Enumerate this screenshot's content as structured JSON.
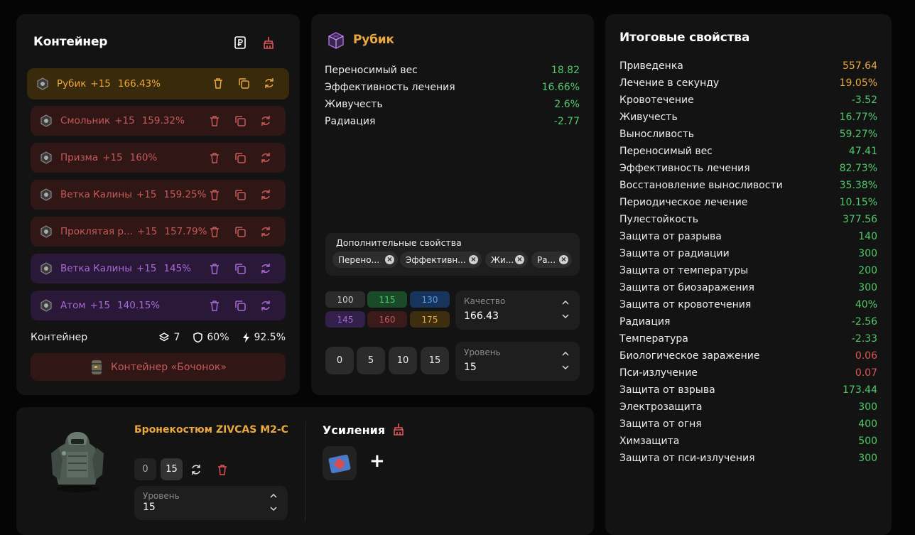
{
  "container": {
    "title": "Контейнер",
    "items": [
      {
        "name": "Рубик",
        "level": "+15",
        "percent": "166.43%",
        "style": "gold"
      },
      {
        "name": "Смольник",
        "level": "+15",
        "percent": "159.32%",
        "style": "red"
      },
      {
        "name": "Призма",
        "level": "+15",
        "percent": "160%",
        "style": "red"
      },
      {
        "name": "Ветка Калины",
        "level": "+15",
        "percent": "159.25%",
        "style": "red"
      },
      {
        "name": "Проклятая р...",
        "level": "+15",
        "percent": "157.79%",
        "style": "red"
      },
      {
        "name": "Ветка Калины",
        "level": "+15",
        "percent": "145%",
        "style": "purple"
      },
      {
        "name": "Атом",
        "level": "+15",
        "percent": "140.15%",
        "style": "purple"
      }
    ],
    "footer": {
      "label": "Контейнер",
      "slots": "7",
      "protection": "60%",
      "efficiency": "92.5%"
    },
    "selected_container": "Контейнер «Бочонок»"
  },
  "artifact": {
    "name": "Рубик",
    "stats": [
      {
        "label": "Переносимый вес",
        "value": "18.82"
      },
      {
        "label": "Эффективность лечения",
        "value": "16.66%"
      },
      {
        "label": "Живучесть",
        "value": "2.6%"
      },
      {
        "label": "Радиация",
        "value": "-2.77"
      }
    ],
    "extra": {
      "label": "Дополнительные свойства",
      "chips": [
        "Перено...",
        "Эффективн...",
        "Жи...",
        "Ра..."
      ]
    },
    "quality_presets": [
      "100",
      "115",
      "130",
      "145",
      "160",
      "175"
    ],
    "quality": {
      "label": "Качество",
      "value": "166.43"
    },
    "level_presets": [
      "0",
      "5",
      "10",
      "15"
    ],
    "level": {
      "label": "Уровень",
      "value": "15"
    }
  },
  "summary": {
    "title": "Итоговые свойства",
    "rows": [
      {
        "label": "Приведенка",
        "value": "557.64",
        "color": "orange"
      },
      {
        "label": "Лечение в секунду",
        "value": "19.05%",
        "color": "orange"
      },
      {
        "label": "Кровотечение",
        "value": "-3.52",
        "color": "green"
      },
      {
        "label": "Живучесть",
        "value": "16.77%",
        "color": "green"
      },
      {
        "label": "Выносливость",
        "value": "59.27%",
        "color": "green"
      },
      {
        "label": "Переносимый вес",
        "value": "47.41",
        "color": "green"
      },
      {
        "label": "Эффективность лечения",
        "value": "82.73%",
        "color": "green"
      },
      {
        "label": "Восстановление выносливости",
        "value": "35.38%",
        "color": "green"
      },
      {
        "label": "Периодическое лечение",
        "value": "10.15%",
        "color": "green"
      },
      {
        "label": "Пулестойкость",
        "value": "377.56",
        "color": "green"
      },
      {
        "label": "Защита от разрыва",
        "value": "140",
        "color": "green"
      },
      {
        "label": "Защита от радиации",
        "value": "300",
        "color": "green"
      },
      {
        "label": "Защита от температуры",
        "value": "200",
        "color": "green"
      },
      {
        "label": "Защита от биозаражения",
        "value": "300",
        "color": "green"
      },
      {
        "label": "Защита от кровотечения",
        "value": "40%",
        "color": "green"
      },
      {
        "label": "Радиация",
        "value": "-2.56",
        "color": "green"
      },
      {
        "label": "Температура",
        "value": "-2.33",
        "color": "green"
      },
      {
        "label": "Биологическое заражение",
        "value": "0.06",
        "color": "red"
      },
      {
        "label": "Пси-излучение",
        "value": "0.07",
        "color": "red"
      },
      {
        "label": "Защита от взрыва",
        "value": "173.44",
        "color": "green"
      },
      {
        "label": "Электрозащита",
        "value": "300",
        "color": "green"
      },
      {
        "label": "Защита от огня",
        "value": "400",
        "color": "green"
      },
      {
        "label": "Химзащита",
        "value": "500",
        "color": "green"
      },
      {
        "label": "Защита от пси-излучения",
        "value": "300",
        "color": "green"
      }
    ]
  },
  "armor": {
    "name": "Бронекостюм ZIVCAS M2-C",
    "level_presets": [
      "0",
      "15"
    ],
    "level": {
      "label": "Уровень",
      "value": "15"
    },
    "boosts_title": "Усиления",
    "add_label": "+"
  },
  "colors": {
    "orange": "#eaa83e",
    "green": "#4ec96a",
    "red": "#e05555",
    "purple": "#a66ad4"
  }
}
